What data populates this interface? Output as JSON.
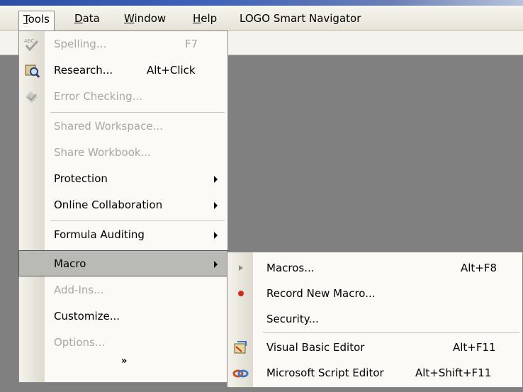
{
  "menubar": {
    "items": [
      {
        "label": "Tools"
      },
      {
        "label": "Data"
      },
      {
        "label": "Window"
      },
      {
        "label": "Help"
      }
    ],
    "smart_navigator": "LOGO Smart Navigator"
  },
  "tools_menu": {
    "items": [
      {
        "label": "Spelling...",
        "shortcut": "F7",
        "enabled": false,
        "icon": "spelling-icon"
      },
      {
        "label": "Research...",
        "shortcut": "Alt+Click",
        "enabled": true,
        "icon": "research-icon"
      },
      {
        "label": "Error Checking...",
        "enabled": false,
        "icon": "error-checking-icon"
      },
      {
        "label": "Shared Workspace...",
        "enabled": false
      },
      {
        "label": "Share Workbook...",
        "enabled": false
      },
      {
        "label": "Protection",
        "enabled": true,
        "submenu": true
      },
      {
        "label": "Online Collaboration",
        "enabled": true,
        "submenu": true
      },
      {
        "label": "Formula Auditing",
        "enabled": true,
        "submenu": true
      },
      {
        "label": "Macro",
        "enabled": true,
        "submenu": true,
        "highlighted": true
      },
      {
        "label": "Add-Ins...",
        "enabled": false
      },
      {
        "label": "Customize...",
        "enabled": true
      },
      {
        "label": "Options...",
        "enabled": false
      }
    ],
    "expand_glyph": "»"
  },
  "macro_menu": {
    "items": [
      {
        "label": "Macros...",
        "shortcut": "Alt+F8",
        "icon": "run-macro-icon"
      },
      {
        "label": "Record New Macro...",
        "icon": "record-icon"
      },
      {
        "label": "Security...",
        "icon": ""
      },
      {
        "label": "Visual Basic Editor",
        "shortcut": "Alt+F11",
        "icon": "vb-editor-icon"
      },
      {
        "label": "Microsoft Script Editor",
        "shortcut": "Alt+Shift+F11",
        "icon": "script-editor-icon"
      }
    ]
  },
  "colors": {
    "menu_bg": "#fbfaf6",
    "disabled_text": "#a8a8a3",
    "highlight_bg": "#b9b9b6",
    "workspace_bg": "#808080"
  }
}
